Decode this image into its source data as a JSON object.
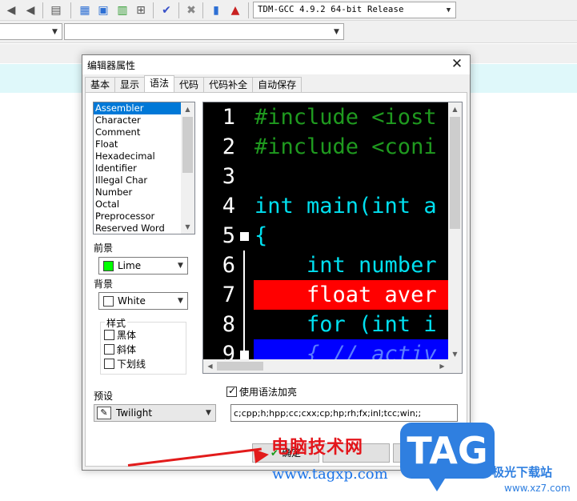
{
  "toolbar": {
    "compiler_select": "TDM-GCC 4.9.2 64-bit Release",
    "icons": [
      "back-icon",
      "forward-icon",
      "bookmark-icon",
      "grid-icon",
      "window-icon",
      "panel-icon",
      "tiles-icon",
      "check-icon",
      "delete-icon",
      "chart-icon",
      "profile-icon"
    ]
  },
  "dialog": {
    "title": "编辑器属性",
    "close": "✕",
    "tabs": [
      "基本",
      "显示",
      "语法",
      "代码",
      "代码补全",
      "自动保存"
    ],
    "active_tab": "语法",
    "tokens": [
      "Assembler",
      "Character",
      "Comment",
      "Float",
      "Hexadecimal",
      "Identifier",
      "Illegal Char",
      "Number",
      "Octal",
      "Preprocessor",
      "Reserved Word"
    ],
    "selected_token": "Assembler",
    "foreground_label": "前景",
    "foreground_value": "Lime",
    "foreground_color": "#00ff00",
    "background_label": "背景",
    "background_value": "White",
    "background_color": "#ffffff",
    "style_label": "样式",
    "style_options": [
      "黑体",
      "斜体",
      "下划线"
    ],
    "preset_label": "预设",
    "preset_value": "Twilight",
    "use_syntax_label": "使用语法加亮",
    "use_syntax_checked": true,
    "extensions": "c;cpp;h;hpp;cc;cxx;cp;hp;rh;fx;inl;tcc;win;;",
    "ok_label": "确定"
  },
  "code_preview": {
    "lines": [
      {
        "num": "1",
        "text": "#include <iost",
        "color": "#1f9a1f",
        "band": ""
      },
      {
        "num": "2",
        "text": "#include <coni",
        "color": "#1f9a1f",
        "band": ""
      },
      {
        "num": "3",
        "text": "",
        "color": "#ffffff",
        "band": ""
      },
      {
        "num": "4",
        "text": "int main(int a",
        "color": "#00e0f0",
        "band": ""
      },
      {
        "num": "5",
        "text": "{",
        "color": "#00e0f0",
        "band": ""
      },
      {
        "num": "6",
        "text": "    int number",
        "color": "#00e0f0",
        "band": ""
      },
      {
        "num": "7",
        "text": "    float aver",
        "color": "#ffffff",
        "band": "#ff0000"
      },
      {
        "num": "8",
        "text": "    for (int i",
        "color": "#00e0f0",
        "band": ""
      },
      {
        "num": "9",
        "text": "    { // activ",
        "color": "#5a7cff",
        "band": "#0000ff"
      }
    ]
  },
  "watermark": {
    "cn": "电脑技术网",
    "url": "www.tagxp.com",
    "logo": "TAG",
    "site": "极光下载站",
    "url2": "www.xz7.com"
  }
}
